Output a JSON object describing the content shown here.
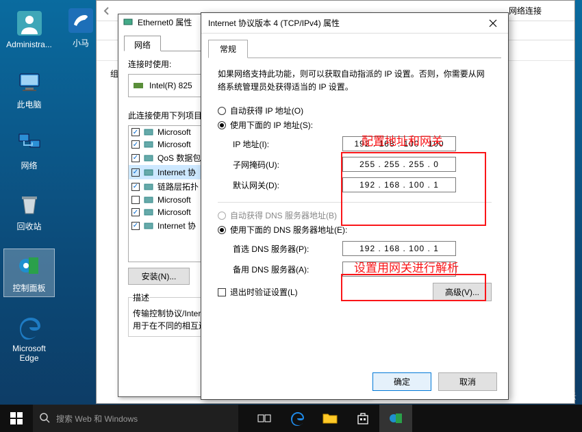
{
  "desktop": {
    "icons": [
      "Administra...",
      "此电脑",
      "网络",
      "回收站",
      "控制面板",
      "Microsoft Edge"
    ],
    "icon2": "小马"
  },
  "explorer_back": {
    "title": "网络连接",
    "toolbar_left": "组"
  },
  "ethernet_props": {
    "window_title": "Ethernet0 属性",
    "tab": "网络",
    "connect_using_label": "连接时使用:",
    "adapter": "Intel(R) 825",
    "uses_items_label": "此连接使用下列项目",
    "items": [
      {
        "checked": true,
        "label": "Microsoft"
      },
      {
        "checked": true,
        "label": "Microsoft"
      },
      {
        "checked": true,
        "label": "QoS 数据包"
      },
      {
        "checked": true,
        "label": "Internet 协",
        "selected": true
      },
      {
        "checked": true,
        "label": "链路层拓扑"
      },
      {
        "checked": false,
        "label": "Microsoft"
      },
      {
        "checked": true,
        "label": "Microsoft"
      },
      {
        "checked": true,
        "label": "Internet 协"
      }
    ],
    "install_btn": "安装(N)...",
    "desc_legend": "描述",
    "desc_text": "传输控制协议/Internet 协议。该协议是默认的广域网络协议，用于在不同的相互连接的网络上通信。"
  },
  "ipv4": {
    "title": "Internet 协议版本 4 (TCP/IPv4) 属性",
    "tab": "常规",
    "intro": "如果网络支持此功能，则可以获取自动指派的 IP 设置。否则，你需要从网络系统管理员处获得适当的 IP 设置。",
    "auto_ip_label": "自动获得 IP 地址(O)",
    "manual_ip_label": "使用下面的 IP 地址(S):",
    "ip_label": "IP 地址(I):",
    "mask_label": "子网掩码(U):",
    "gw_label": "默认网关(D):",
    "ip_value": "192 . 168 . 100 . 100",
    "mask_value": "255 . 255 . 255 .   0",
    "gw_value": "192 . 168 . 100 .   1",
    "auto_dns_label": "自动获得 DNS 服务器地址(B)",
    "manual_dns_label": "使用下面的 DNS 服务器地址(E):",
    "pref_dns_label": "首选 DNS 服务器(P):",
    "alt_dns_label": "备用 DNS 服务器(A):",
    "pref_dns_value": "192 . 168 . 100 .   1",
    "alt_dns_value": ".       .       .",
    "exit_verify_label": "退出时验证设置(L)",
    "advanced_btn": "高级(V)...",
    "ok_btn": "确定",
    "cancel_btn": "取消"
  },
  "annotations": {
    "a1": "配置地址和网关",
    "a2": "设置用网关进行解析"
  },
  "taskbar": {
    "search_placeholder": "搜索 Web 和 Windows"
  },
  "watermark": "亿速云"
}
